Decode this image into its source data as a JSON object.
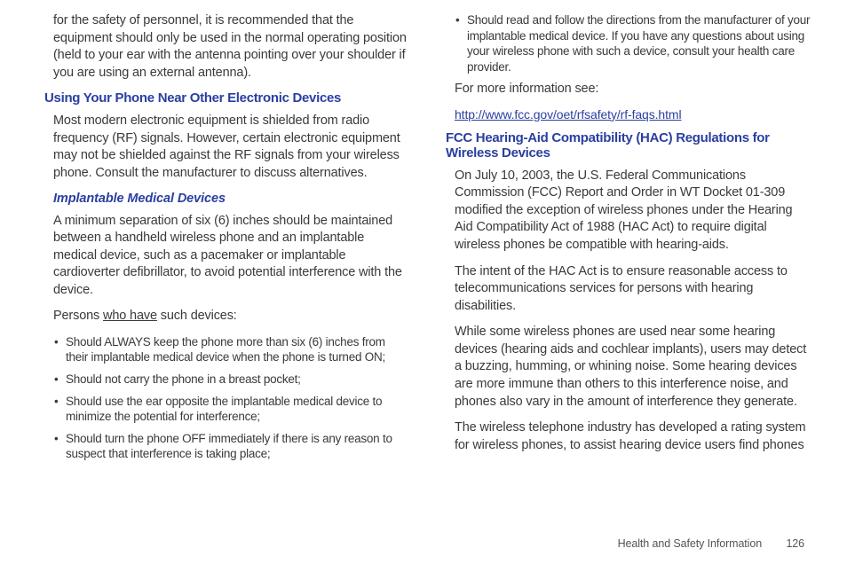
{
  "left": {
    "intro": "for the safety of personnel, it is recommended that the equipment should only be used in the normal operating position (held to your ear with the antenna pointing over your shoulder if you are using an external antenna).",
    "h1": "Using Your Phone Near Other Electronic Devices",
    "p1": "Most modern electronic equipment is shielded from radio frequency (RF) signals. However, certain electronic equipment may not be shielded against the RF signals from your wireless phone. Consult the manufacturer to discuss alternatives.",
    "h2": "Implantable Medical Devices",
    "p2": "A minimum separation of six (6) inches should be maintained between a handheld wireless phone and an implantable medical device, such as a pacemaker or implantable cardioverter defibrillator, to avoid potential interference with the device.",
    "p3_prefix": "Persons ",
    "p3_underline": "who have",
    "p3_suffix": " such devices:",
    "bullets": [
      "Should ALWAYS keep the phone more than six (6) inches from their implantable medical device when the phone is turned ON;",
      "Should not carry the phone in a breast pocket;",
      "Should use the ear opposite the implantable medical device to minimize the potential for interference;",
      "Should turn the phone OFF immediately if there is any reason to suspect that interference is taking place;"
    ]
  },
  "right": {
    "bullets": [
      "Should read and follow the directions from the manufacturer of your implantable medical device. If you have any questions about using your wireless phone with such a device, consult your health care provider."
    ],
    "p1": "For more information see:",
    "link": "http://www.fcc.gov/oet/rfsafety/rf-faqs.html",
    "h1": "FCC Hearing-Aid Compatibility (HAC) Regulations for Wireless Devices",
    "p2": "On July 10, 2003, the U.S. Federal Communications Commission (FCC) Report and Order in WT Docket 01-309 modified the exception of wireless phones under the Hearing Aid Compatibility Act of 1988 (HAC Act) to require digital wireless phones be compatible with hearing-aids.",
    "p3": "The intent of the HAC Act is to ensure reasonable access to telecommunications services for persons with hearing disabilities.",
    "p4": "While some wireless phones are used near some hearing devices (hearing aids and cochlear implants), users may detect a buzzing, humming, or whining noise. Some hearing devices are more immune than others to this interference noise, and phones also vary in the amount of interference they generate.",
    "p5": "The wireless telephone industry has developed a rating system for wireless phones, to assist hearing device users find phones"
  },
  "footer": {
    "section": "Health and Safety Information",
    "page": "126"
  }
}
